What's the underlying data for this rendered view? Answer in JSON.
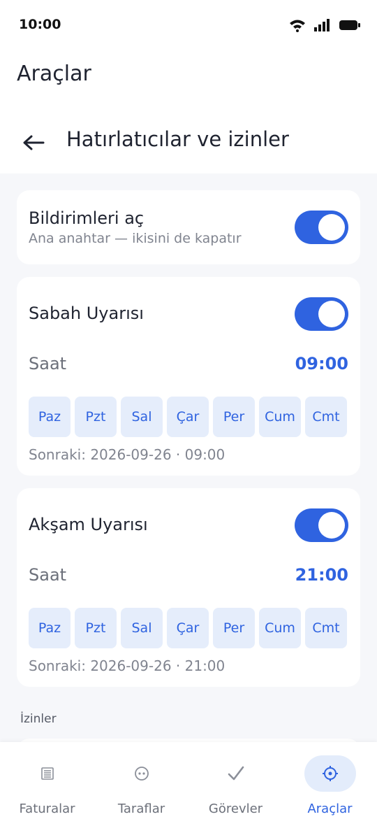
{
  "status_bar": {
    "time": "10:00"
  },
  "app": {
    "title": "Araçlar"
  },
  "screen": {
    "title": "Hatırlatıcılar ve izinler"
  },
  "master": {
    "label": "Bildirimleri aç",
    "subtitle": "Ana anahtar — ikisini de kapatır",
    "enabled": true
  },
  "morning": {
    "label": "Sabah Uyarısı",
    "enabled": true,
    "time_label": "Saat",
    "time_value": "09:00",
    "days": [
      "Paz",
      "Pzt",
      "Sal",
      "Çar",
      "Per",
      "Cum",
      "Cmt"
    ],
    "next": "Sonraki: 2026-09-26 · 09:00"
  },
  "evening": {
    "label": "Akşam Uyarısı",
    "enabled": true,
    "time_label": "Saat",
    "time_value": "21:00",
    "days": [
      "Paz",
      "Pzt",
      "Sal",
      "Çar",
      "Per",
      "Cum",
      "Cmt"
    ],
    "next": "Sonraki: 2026-09-26 · 21:00"
  },
  "permissions": {
    "section_title": "İzinler"
  },
  "nav": {
    "items": [
      {
        "label": "Faturalar",
        "icon": "receipt-icon"
      },
      {
        "label": "Taraflar",
        "icon": "people-icon"
      },
      {
        "label": "Görevler",
        "icon": "check-icon"
      },
      {
        "label": "Araçlar",
        "icon": "gear-icon",
        "active": true
      }
    ]
  },
  "colors": {
    "accent": "#2f63e0",
    "chip_bg": "#e5edfb",
    "bg": "#f6f7fa"
  }
}
